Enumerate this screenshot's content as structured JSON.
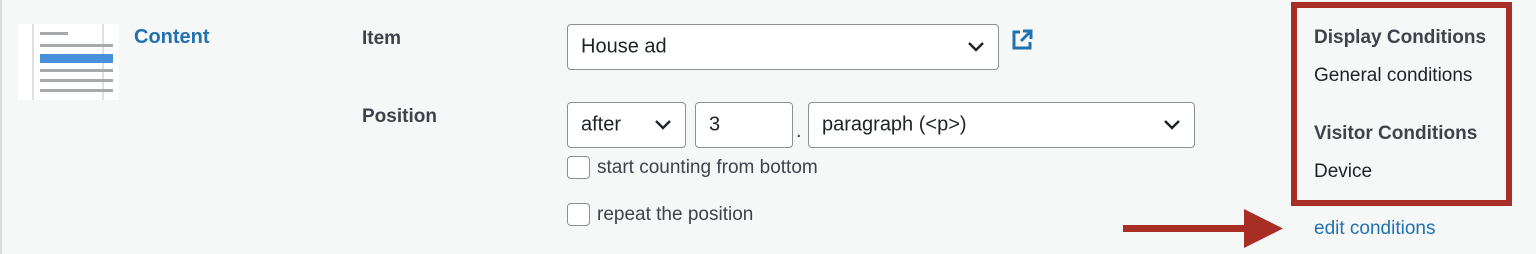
{
  "placement": {
    "name_link": "Content",
    "item_label": "Item",
    "item_value": "House ad",
    "position_label": "Position",
    "position_when": "after",
    "position_index": "3",
    "position_separator": ".",
    "position_element": "paragraph (<p>)",
    "checkbox_count_bottom": "start counting from bottom",
    "checkbox_repeat": "repeat the position"
  },
  "conditions": {
    "display_heading": "Display Conditions",
    "display_value": "General conditions",
    "visitor_heading": "Visitor Conditions",
    "visitor_value": "Device",
    "edit_link": "edit conditions"
  },
  "colors": {
    "accent": "#2271b1",
    "highlight_box": "#a82d24",
    "background": "#f6f7f7"
  },
  "icons": [
    "content-placement-thumbnail-icon",
    "external-link-icon",
    "chevron-down-icon",
    "arrow-right-icon"
  ]
}
